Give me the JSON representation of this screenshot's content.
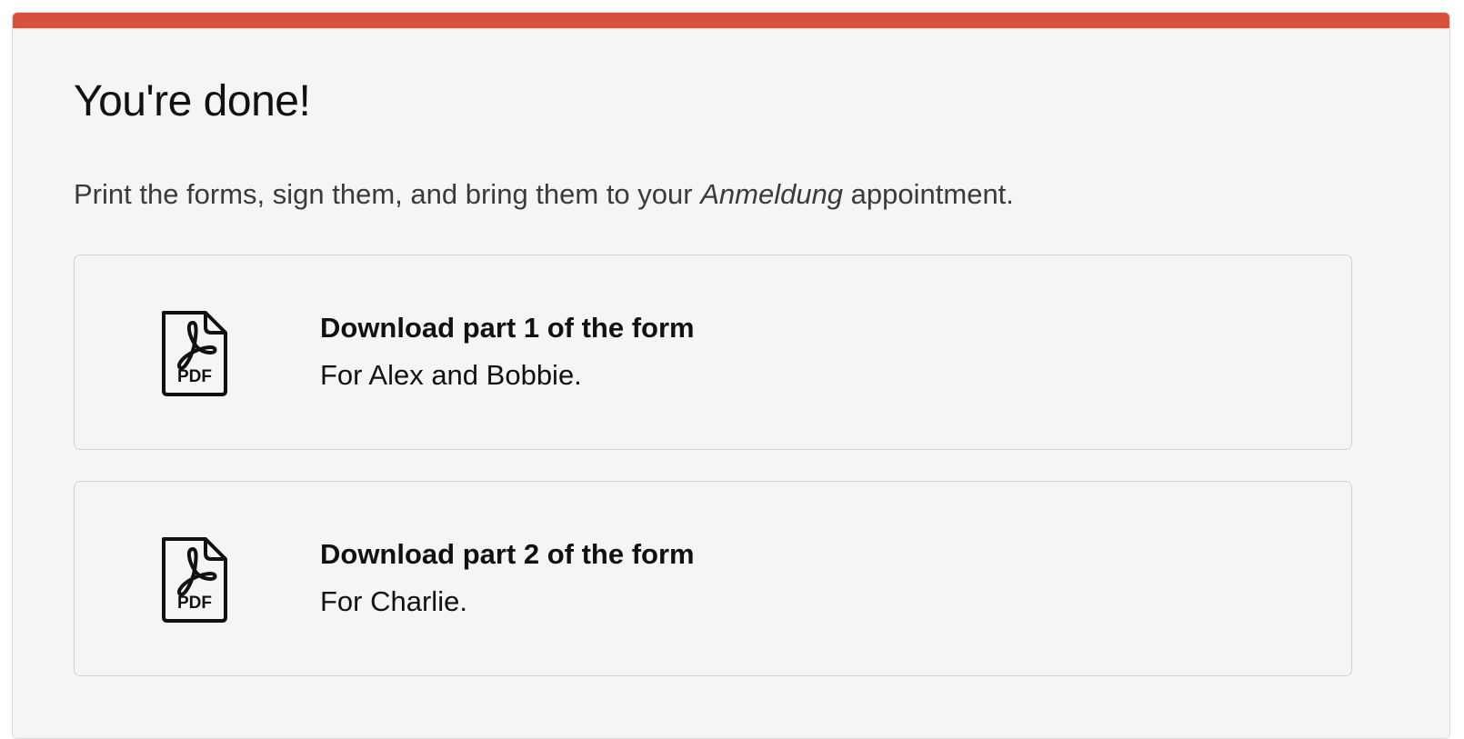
{
  "header": {
    "accent_color": "#d9503c"
  },
  "main": {
    "title": "You're done!",
    "intro": {
      "before": "Print the forms, sign them, and bring them to your ",
      "emphasis": "Anmeldung",
      "after": " appointment."
    },
    "downloads": [
      {
        "icon": "pdf-file-icon",
        "icon_label": "PDF",
        "title": "Download part 1 of the form",
        "subtitle": "For Alex and Bobbie."
      },
      {
        "icon": "pdf-file-icon",
        "icon_label": "PDF",
        "title": "Download part 2 of the form",
        "subtitle": "For Charlie."
      }
    ]
  }
}
